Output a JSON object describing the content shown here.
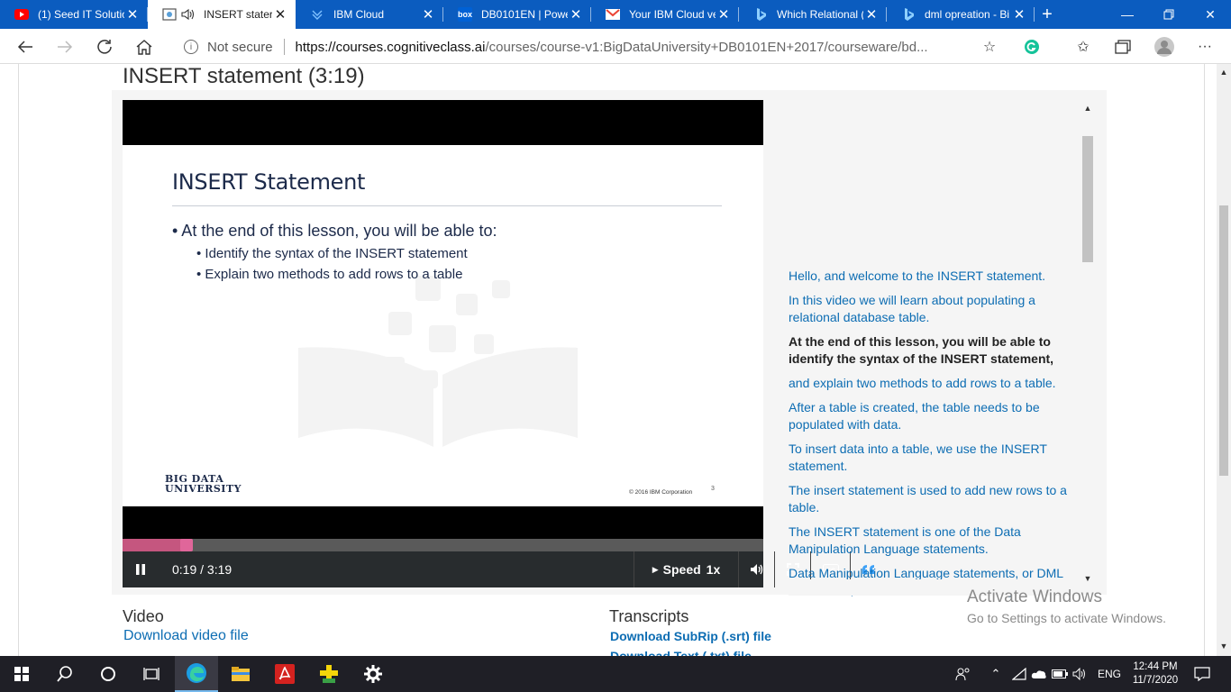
{
  "browser": {
    "tabs": [
      {
        "title": "(1) Seed IT Solutio",
        "icon": "youtube-icon"
      },
      {
        "title": "INSERT stater",
        "icon": "course-icon",
        "active": true
      },
      {
        "title": "IBM Cloud",
        "icon": "ibm-cloud-icon"
      },
      {
        "title": "DB0101EN | Powe",
        "icon": "box-icon"
      },
      {
        "title": "Your IBM Cloud ve",
        "icon": "gmail-icon"
      },
      {
        "title": "Which Relational (",
        "icon": "bing-icon"
      },
      {
        "title": "dml opreation - Bi",
        "icon": "bing-icon"
      }
    ],
    "box_favicon_text": "box",
    "security_label": "Not secure",
    "url_domain": "https://courses.cognitiveclass.ai",
    "url_path": "/courses/course-v1:BigDataUniversity+DB0101EN+2017/courseware/bd..."
  },
  "page": {
    "lesson_title": "INSERT statement (3:19)",
    "slide": {
      "title": "INSERT Statement",
      "bullet_main": "• At the end of this lesson, you will be able to:",
      "bullet_1": "• Identify the syntax of the INSERT statement",
      "bullet_2": "• Explain two methods to add rows to a table",
      "logo_line1": "BIG DATA",
      "logo_line2": "UNIVERSITY",
      "copyright": "© 2016 IBM Corporation",
      "page_number": "3"
    },
    "player": {
      "time": "0:19 / 3:19",
      "progress": 0.1,
      "speed_label": "Speed",
      "speed_value": "1x",
      "accent_color": "#c5567f"
    },
    "transcript": [
      "Hello, and welcome to the INSERT statement.",
      "In this video we will learn about populating a relational database table.",
      "At the end of this lesson, you will be able to identify the syntax of the INSERT statement,",
      "and explain two methods to add rows to a table.",
      "After a table is created, the table needs to be populated with data.",
      "To insert data into a table, we use the INSERT statement.",
      "The insert statement is used to add new rows to a table.",
      "The INSERT statement is one of the Data Manipulation Language statements.",
      "Data Manipulation Language statements, or DML statements, are used to read and modify"
    ],
    "current_transcript_index": 2,
    "video_heading": "Video",
    "video_link": "Download video file",
    "transcripts_heading": "Transcripts",
    "transcript_link_srt": "Download SubRip (.srt) file",
    "transcript_link_txt": "Download Text (.txt) file"
  },
  "activation": {
    "title": "Activate Windows",
    "subtitle": "Go to Settings to activate Windows."
  },
  "taskbar": {
    "language": "ENG",
    "time": "12:44 PM",
    "date": "11/7/2020"
  }
}
